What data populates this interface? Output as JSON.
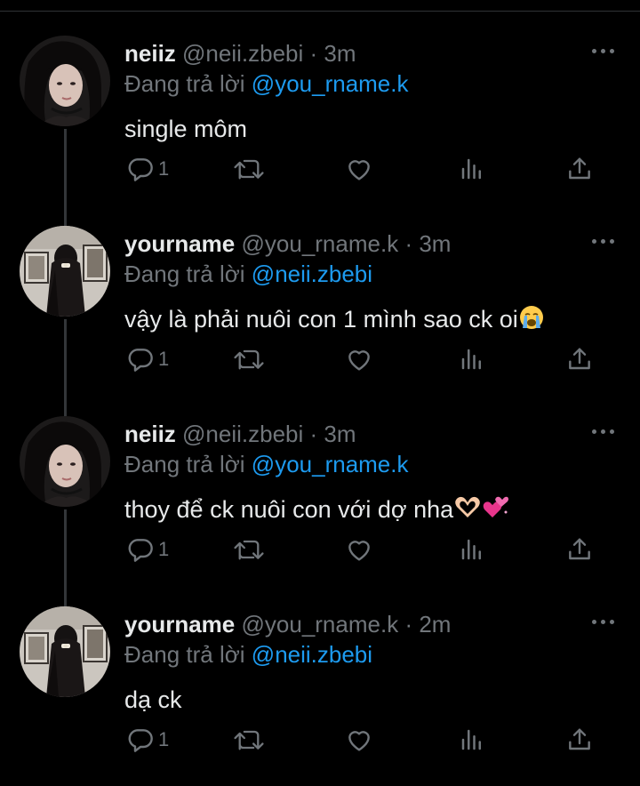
{
  "tweets": [
    {
      "name": "neiiz",
      "handle": "@neii.zbebi",
      "time": "3m",
      "reply_prefix": "Đang trả lời",
      "reply_to": "@you_rname.k",
      "text": "single môm",
      "reply_count": "1",
      "avatar": "avatar-girl"
    },
    {
      "name": "yourname",
      "handle": "@you_rname.k",
      "time": "3m",
      "reply_prefix": "Đang trả lời",
      "reply_to": "@neii.zbebi",
      "text": "vậy là phải nuôi con 1 mình sao ck oi",
      "emoji": [
        "crying-face-emoji"
      ],
      "reply_count": "1",
      "avatar": "avatar-gallery"
    },
    {
      "name": "neiiz",
      "handle": "@neii.zbebi",
      "time": "3m",
      "reply_prefix": "Đang trả lời",
      "reply_to": "@you_rname.k",
      "text": "thoy để ck nuôi con với dợ nha",
      "emoji": [
        "heart-hands-emoji",
        "revolving-hearts-emoji"
      ],
      "reply_count": "1",
      "avatar": "avatar-girl"
    },
    {
      "name": "yourname",
      "handle": "@you_rname.k",
      "time": "2m",
      "reply_prefix": "Đang trả lời",
      "reply_to": "@neii.zbebi",
      "text": "dạ ck",
      "reply_count": "1",
      "avatar": "avatar-gallery"
    }
  ],
  "separator": "·",
  "icons": [
    "reply-icon",
    "retweet-icon",
    "like-icon",
    "views-icon",
    "share-icon",
    "more-icon"
  ],
  "colors": {
    "background": "#000000",
    "primary_text": "#e7e9ea",
    "secondary_text": "#71767b",
    "mention": "#1d9bf0",
    "thread_line": "#333639"
  }
}
